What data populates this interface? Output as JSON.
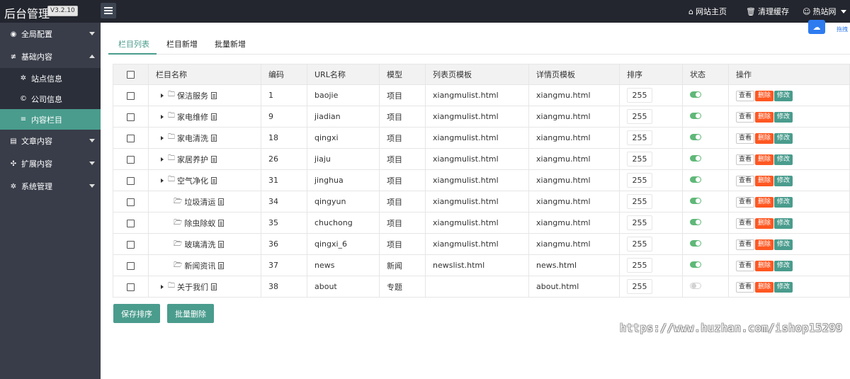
{
  "header": {
    "logo": "后台管理",
    "version": "V3.2.10",
    "nav": [
      {
        "icon": "home-icon",
        "glyph": "⌂",
        "label": "网站主页"
      },
      {
        "icon": "trash-icon",
        "glyph": "🗑",
        "label": "清理缓存"
      },
      {
        "icon": "user-icon",
        "glyph": "☺",
        "label": "热站网"
      }
    ]
  },
  "sidebar": {
    "groups": [
      {
        "icon": "globe-icon",
        "label": "全局配置"
      },
      {
        "icon": "sliders-icon",
        "label": "基础内容"
      },
      {
        "icon": "document-icon",
        "label": "文章内容"
      },
      {
        "icon": "expand-icon",
        "label": "扩展内容"
      },
      {
        "icon": "gear-icon",
        "label": "系统管理"
      }
    ],
    "sub_items": [
      {
        "icon": "gear-icon",
        "label": "站点信息"
      },
      {
        "icon": "copyright-icon",
        "label": "公司信息"
      },
      {
        "icon": "list-icon",
        "label": "内容栏目"
      }
    ]
  },
  "tabs": [
    "栏目列表",
    "栏目新增",
    "批量新增"
  ],
  "floating": {
    "cloud_text": "拖拽"
  },
  "table": {
    "headers": [
      "栏目名称",
      "编码",
      "URL名称",
      "模型",
      "列表页模板",
      "详情页模板",
      "排序",
      "状态",
      "操作"
    ],
    "rows": [
      {
        "name": "保洁服务",
        "id": "1",
        "url": "baojie",
        "model": "项目",
        "list_tpl": "xiangmulist.html",
        "detail_tpl": "xiangmu.html",
        "sort": "255",
        "status": true,
        "expandable": true
      },
      {
        "name": "家电维修",
        "id": "9",
        "url": "jiadian",
        "model": "项目",
        "list_tpl": "xiangmulist.html",
        "detail_tpl": "xiangmu.html",
        "sort": "255",
        "status": true,
        "expandable": true
      },
      {
        "name": "家电清洗",
        "id": "18",
        "url": "qingxi",
        "model": "项目",
        "list_tpl": "xiangmulist.html",
        "detail_tpl": "xiangmu.html",
        "sort": "255",
        "status": true,
        "expandable": true
      },
      {
        "name": "家居养护",
        "id": "26",
        "url": "jiaju",
        "model": "项目",
        "list_tpl": "xiangmulist.html",
        "detail_tpl": "xiangmu.html",
        "sort": "255",
        "status": true,
        "expandable": true
      },
      {
        "name": "空气净化",
        "id": "31",
        "url": "jinghua",
        "model": "项目",
        "list_tpl": "xiangmulist.html",
        "detail_tpl": "xiangmu.html",
        "sort": "255",
        "status": true,
        "expandable": true
      },
      {
        "name": "垃圾清运",
        "id": "34",
        "url": "qingyun",
        "model": "项目",
        "list_tpl": "xiangmulist.html",
        "detail_tpl": "xiangmu.html",
        "sort": "255",
        "status": true,
        "expandable": false
      },
      {
        "name": "除虫除蚁",
        "id": "35",
        "url": "chuchong",
        "model": "项目",
        "list_tpl": "xiangmulist.html",
        "detail_tpl": "xiangmu.html",
        "sort": "255",
        "status": true,
        "expandable": false
      },
      {
        "name": "玻璃清洗",
        "id": "36",
        "url": "qingxi_6",
        "model": "项目",
        "list_tpl": "xiangmulist.html",
        "detail_tpl": "xiangmu.html",
        "sort": "255",
        "status": true,
        "expandable": false
      },
      {
        "name": "新闻资讯",
        "id": "37",
        "url": "news",
        "model": "新闻",
        "list_tpl": "newslist.html",
        "detail_tpl": "news.html",
        "sort": "255",
        "status": true,
        "expandable": false
      },
      {
        "name": "关于我们",
        "id": "38",
        "url": "about",
        "model": "专题",
        "list_tpl": "",
        "detail_tpl": "about.html",
        "sort": "255",
        "status": false,
        "expandable": true
      }
    ],
    "row_actions": {
      "view": "查看",
      "delete": "删除",
      "edit": "修改"
    }
  },
  "buttons": {
    "save_sort": "保存排序",
    "batch_delete": "批量删除"
  },
  "watermark": "https://www.huzhan.com/ishop15299",
  "colors": {
    "accent": "#4a9c8d",
    "danger": "#ff5722",
    "topbar": "#23262e",
    "sidebar": "#393d49",
    "switch_on": "#5fb878"
  }
}
